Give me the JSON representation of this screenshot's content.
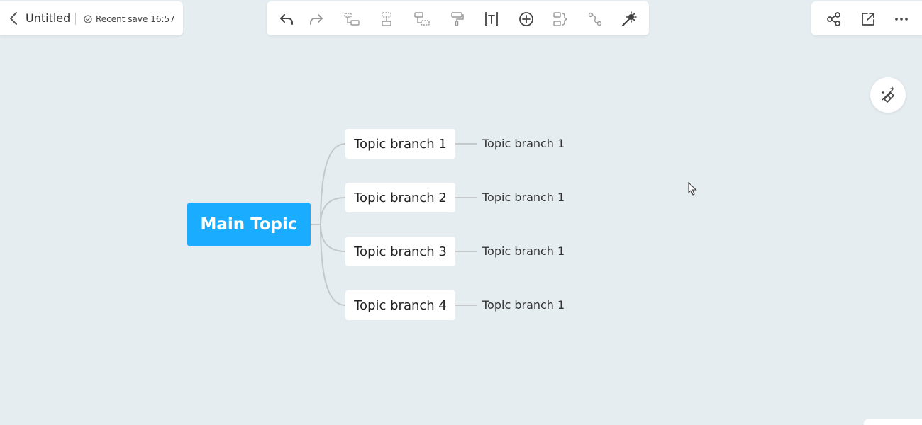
{
  "header": {
    "title": "Untitled",
    "save_status": "Recent save 16:57"
  },
  "toolbar": {
    "items": [
      {
        "name": "undo-icon"
      },
      {
        "name": "redo-icon"
      },
      {
        "name": "insert-subtopic-icon"
      },
      {
        "name": "insert-topic-icon"
      },
      {
        "name": "insert-parent-icon"
      },
      {
        "name": "format-painter-icon"
      },
      {
        "name": "text-icon"
      },
      {
        "name": "add-icon"
      },
      {
        "name": "summary-icon"
      },
      {
        "name": "relationship-icon"
      },
      {
        "name": "magic-icon"
      }
    ]
  },
  "right_actions": {
    "items": [
      {
        "name": "share-icon"
      },
      {
        "name": "export-icon"
      },
      {
        "name": "more-icon"
      }
    ]
  },
  "mindmap": {
    "main_topic": "Main Topic",
    "branches": [
      {
        "label": "Topic branch 1",
        "child": "Topic branch 1"
      },
      {
        "label": "Topic branch 2",
        "child": "Topic branch 1"
      },
      {
        "label": "Topic branch 3",
        "child": "Topic branch 1"
      },
      {
        "label": "Topic branch 4",
        "child": "Topic branch 1"
      }
    ]
  },
  "colors": {
    "canvas_bg": "#e6edf1",
    "main_topic_bg": "#1aacff",
    "connector": "#c4c8cb",
    "icon_active": "#444444",
    "icon_disabled": "#9a9a9a"
  }
}
